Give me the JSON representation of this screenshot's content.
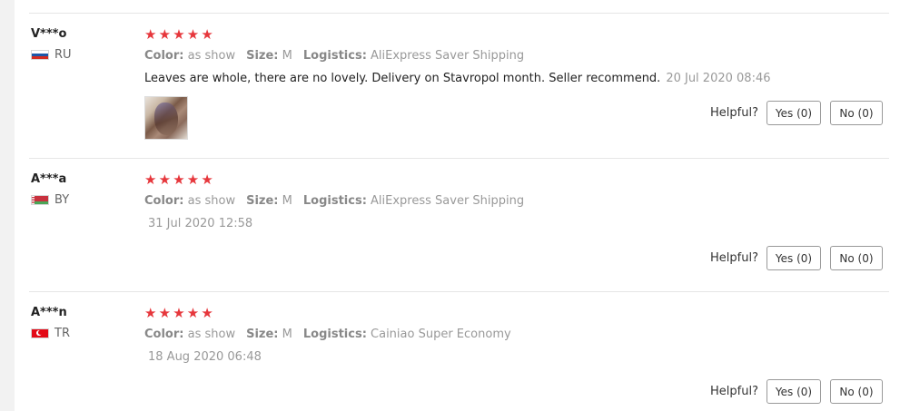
{
  "reviews": [
    {
      "user": "V***o",
      "country": "RU",
      "flag": "russia-flag-icon",
      "stars": 5,
      "color_label": "Color:",
      "color": "as show",
      "size_label": "Size:",
      "size": "M",
      "logistics_label": "Logistics:",
      "logistics": "AliExpress Saver Shipping",
      "text": "Leaves are whole, there are no lovely. Delivery on Stavropol month. Seller recommend.",
      "date": "20 Jul 2020 08:46",
      "has_photo": true,
      "helpful_label": "Helpful?",
      "yes": "Yes (0)",
      "no": "No (0)"
    },
    {
      "user": "A***a",
      "country": "BY",
      "flag": "belarus-flag-icon",
      "stars": 5,
      "color_label": "Color:",
      "color": "as show",
      "size_label": "Size:",
      "size": "M",
      "logistics_label": "Logistics:",
      "logistics": "AliExpress Saver Shipping",
      "text": "",
      "date": "31 Jul 2020 12:58",
      "has_photo": false,
      "helpful_label": "Helpful?",
      "yes": "Yes (0)",
      "no": "No (0)"
    },
    {
      "user": "A***n",
      "country": "TR",
      "flag": "turkey-flag-icon",
      "stars": 5,
      "color_label": "Color:",
      "color": "as show",
      "size_label": "Size:",
      "size": "M",
      "logistics_label": "Logistics:",
      "logistics": "Cainiao Super Economy",
      "text": "",
      "date": "18 Aug 2020 06:48",
      "has_photo": false,
      "helpful_label": "Helpful?",
      "yes": "Yes (0)",
      "no": "No (0)"
    }
  ],
  "colors": {
    "star": "#e6373c",
    "muted": "#999999",
    "divider": "#e6e6e6"
  }
}
